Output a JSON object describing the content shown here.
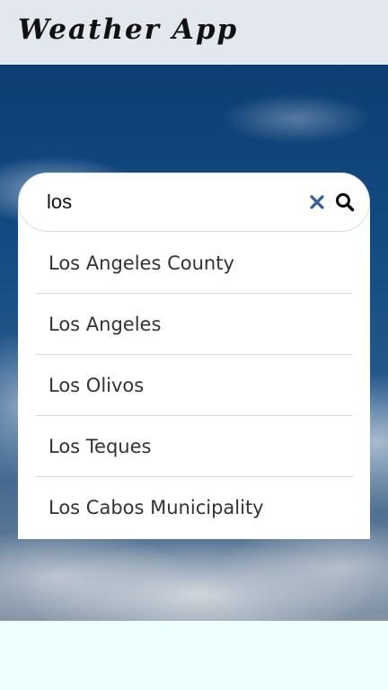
{
  "header": {
    "title": "Weather App"
  },
  "search": {
    "value": "los",
    "clear_icon": "close-icon",
    "search_icon": "search-icon",
    "accent_color": "#2f5f9e"
  },
  "suggestions": [
    "Los Angeles County",
    "Los Angeles",
    "Los Olivos",
    "Los Teques",
    "Los Cabos Municipality"
  ]
}
